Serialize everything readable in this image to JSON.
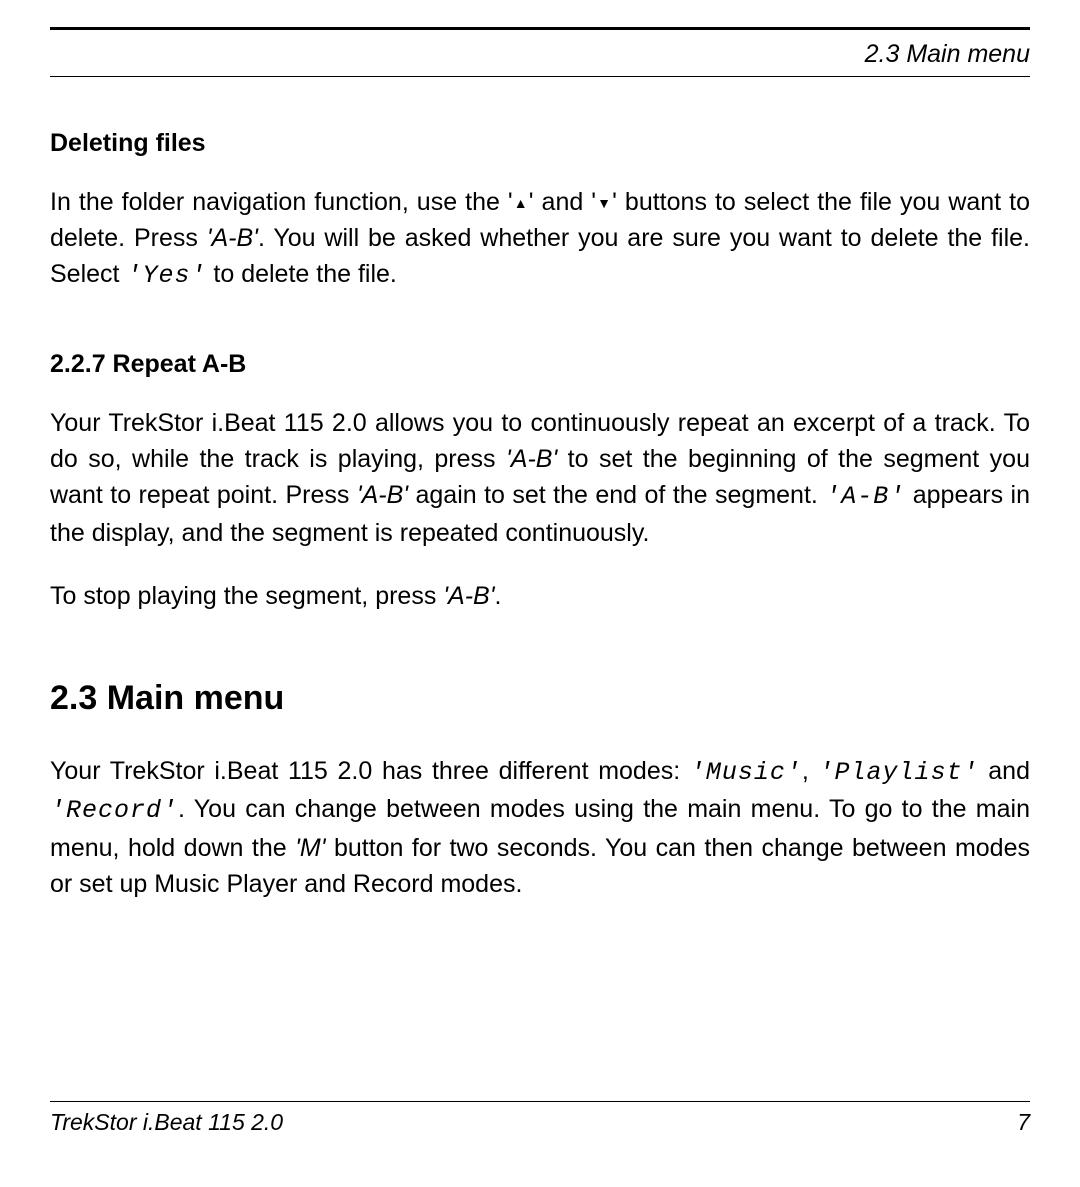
{
  "header": {
    "section_ref": "2.3 Main menu"
  },
  "sec_deleting": {
    "title": "Deleting files",
    "p1_a": "In the folder navigation function, use the '",
    "p1_up": "▲",
    "p1_b": "' and '",
    "p1_down": "▼",
    "p1_c": "' buttons to select the file you want to delete. Press ",
    "p1_ab": "'A-B'",
    "p1_d": ". You will be asked whether you are sure you want to delete the file. Select ",
    "p1_yes": "'Yes'",
    "p1_e": " to delete the file."
  },
  "sec_repeat": {
    "title": "2.2.7  Repeat A-B",
    "p1_a": "Your TrekStor i.Beat 115 2.0 allows you to continuously repeat an excerpt of a track. To do so, while the track is playing, press ",
    "p1_ab1": "'A-B'",
    "p1_b": " to set the beginning of the segment you want to repeat point. Press ",
    "p1_ab2": "'A-B'",
    "p1_c": " again to set the end of the segment.  ",
    "p1_abtt": "'A-B'",
    "p1_d": " appears in the display, and the segment is repeated continuously.",
    "p2_a": "To stop playing the segment, press ",
    "p2_ab": "'A-B'",
    "p2_b": "."
  },
  "sec_main": {
    "title": "2.3  Main menu",
    "p1_a": "Your TrekStor i.Beat 115 2.0 has three different modes: ",
    "p1_music": "'Music'",
    "p1_b": ", ",
    "p1_playlist": "'Play­list'",
    "p1_c": " and ",
    "p1_record": "'Record'",
    "p1_d": ". You can change between modes using the main menu.  To go to the main menu, hold down the ",
    "p1_m": "'M'",
    "p1_e": " button for two seconds. You can then change between modes or set up Music Player and Record modes."
  },
  "footer": {
    "left": "TrekStor i.Beat 115 2.0",
    "right": "7"
  }
}
